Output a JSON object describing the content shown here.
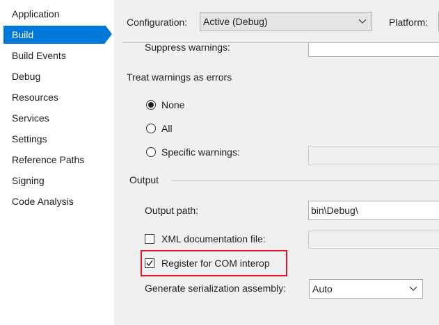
{
  "sidebar": {
    "items": [
      {
        "label": "Application"
      },
      {
        "label": "Build"
      },
      {
        "label": "Build Events"
      },
      {
        "label": "Debug"
      },
      {
        "label": "Resources"
      },
      {
        "label": "Services"
      },
      {
        "label": "Settings"
      },
      {
        "label": "Reference Paths"
      },
      {
        "label": "Signing"
      },
      {
        "label": "Code Analysis"
      }
    ],
    "active": "Build"
  },
  "toolbar": {
    "configuration_label": "Configuration:",
    "configuration_value": "Active (Debug)",
    "platform_label": "Platform:"
  },
  "errors": {
    "suppress_label": "Suppress warnings:",
    "suppress_value": "",
    "treat_heading": "Treat warnings as errors",
    "none_label": "None",
    "all_label": "All",
    "specific_label": "Specific warnings:",
    "specific_value": "",
    "selected": "None"
  },
  "output": {
    "heading": "Output",
    "output_path_label": "Output path:",
    "output_path_value": "bin\\Debug\\",
    "xml_doc_label": "XML documentation file:",
    "xml_doc_checked": false,
    "xml_doc_value": "",
    "com_interop_label": "Register for COM interop",
    "com_interop_checked": true,
    "serialization_label": "Generate serialization assembly:",
    "serialization_value": "Auto"
  },
  "colors": {
    "accent": "#0078d7",
    "highlight": "#e81123"
  }
}
